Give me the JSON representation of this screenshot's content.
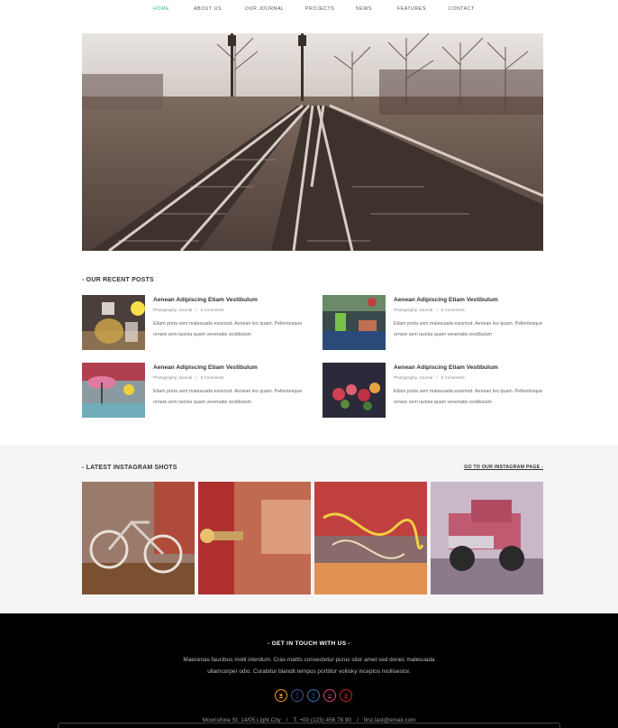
{
  "nav": {
    "items": [
      {
        "label": "HOME",
        "active": true
      },
      {
        "label": "ABOUT US",
        "active": false
      },
      {
        "label": "OUR JOURNAL",
        "active": false
      },
      {
        "label": "PROJECTS",
        "active": false
      },
      {
        "label": "NEWS",
        "active": false
      },
      {
        "label": "FEATURES",
        "active": false
      },
      {
        "label": "CONTACT",
        "active": false
      }
    ]
  },
  "hero": {
    "image": "railway-tracks-photo"
  },
  "recent": {
    "title": "- OUR RECENT POSTS",
    "posts": [
      {
        "title": "Aenean Adipiscing Etiam Vestibulum",
        "category": "Photography, Journal",
        "comments": "5 Comments",
        "excerpt": "Etiam porta sem malesuada euismod. Aenean leo quam. Pellentesque ornare sem lacinia quam venenatis vestibulum",
        "image": "teapot-photo"
      },
      {
        "title": "Aenean Adipiscing Etiam Vestibulum",
        "category": "Photography, Journal",
        "comments": "5 Comments",
        "excerpt": "Etiam porta sem malesuada euismod. Aenean leo quam. Pellentesque ornare sem lacinia quam venenatis vestibulum",
        "image": "cafe-table-photo"
      },
      {
        "title": "Aenean Adipiscing Etiam Vestibulum",
        "category": "Photography, Journal",
        "comments": "5 Comments",
        "excerpt": "Etiam porta sem malesuada euismod. Aenean leo quam. Pellentesque ornare sem lacinia quam venenatis vestibulum",
        "image": "umbrella-street-photo"
      },
      {
        "title": "Aenean Adipiscing Etiam Vestibulum",
        "category": "Photography, Journal",
        "comments": "5 Comments",
        "excerpt": "Etiam porta sem malesuada euismod. Aenean leo quam. Pellentesque ornare sem lacinia quam venenatis vestibulum",
        "image": "flower-stall-photo"
      }
    ]
  },
  "instagram": {
    "title": "- LATEST INSTAGRAM SHOTS",
    "link": "GO TO OUR INSTAGRAM PAGE -",
    "shots": [
      "bicycle-photo",
      "door-handle-photo",
      "wires-photo",
      "old-truck-photo"
    ]
  },
  "footer": {
    "title": "- GET IN TOUCH WITH US -",
    "description": "Maecenas faucibus molli interdum. Cras mattis consectetur purus sitor amet sed donec malesuada ullamcorper odio. Curabitur blandit tempus porttitor vollisky inceptos mollisestor.",
    "socials": [
      {
        "icon": "rss-icon",
        "glyph": "◉",
        "color": "#f39c12"
      },
      {
        "icon": "facebook-icon",
        "glyph": "f",
        "color": "#3b5998"
      },
      {
        "icon": "twitter-icon",
        "glyph": "t",
        "color": "#2b7bb9"
      },
      {
        "icon": "dribbble-icon",
        "glyph": "◎",
        "color": "#d6437f"
      },
      {
        "icon": "pinterest-icon",
        "glyph": "p",
        "color": "#cb2027"
      }
    ],
    "address": "Moonshine St. 14/05 Light City",
    "phone": "T. +00 (123) 456 78 90",
    "email": "first.last@email.com"
  },
  "colors": {
    "accent": "#34b29a",
    "footer_bg": "#000000",
    "band_bg": "#f5f5f5"
  }
}
